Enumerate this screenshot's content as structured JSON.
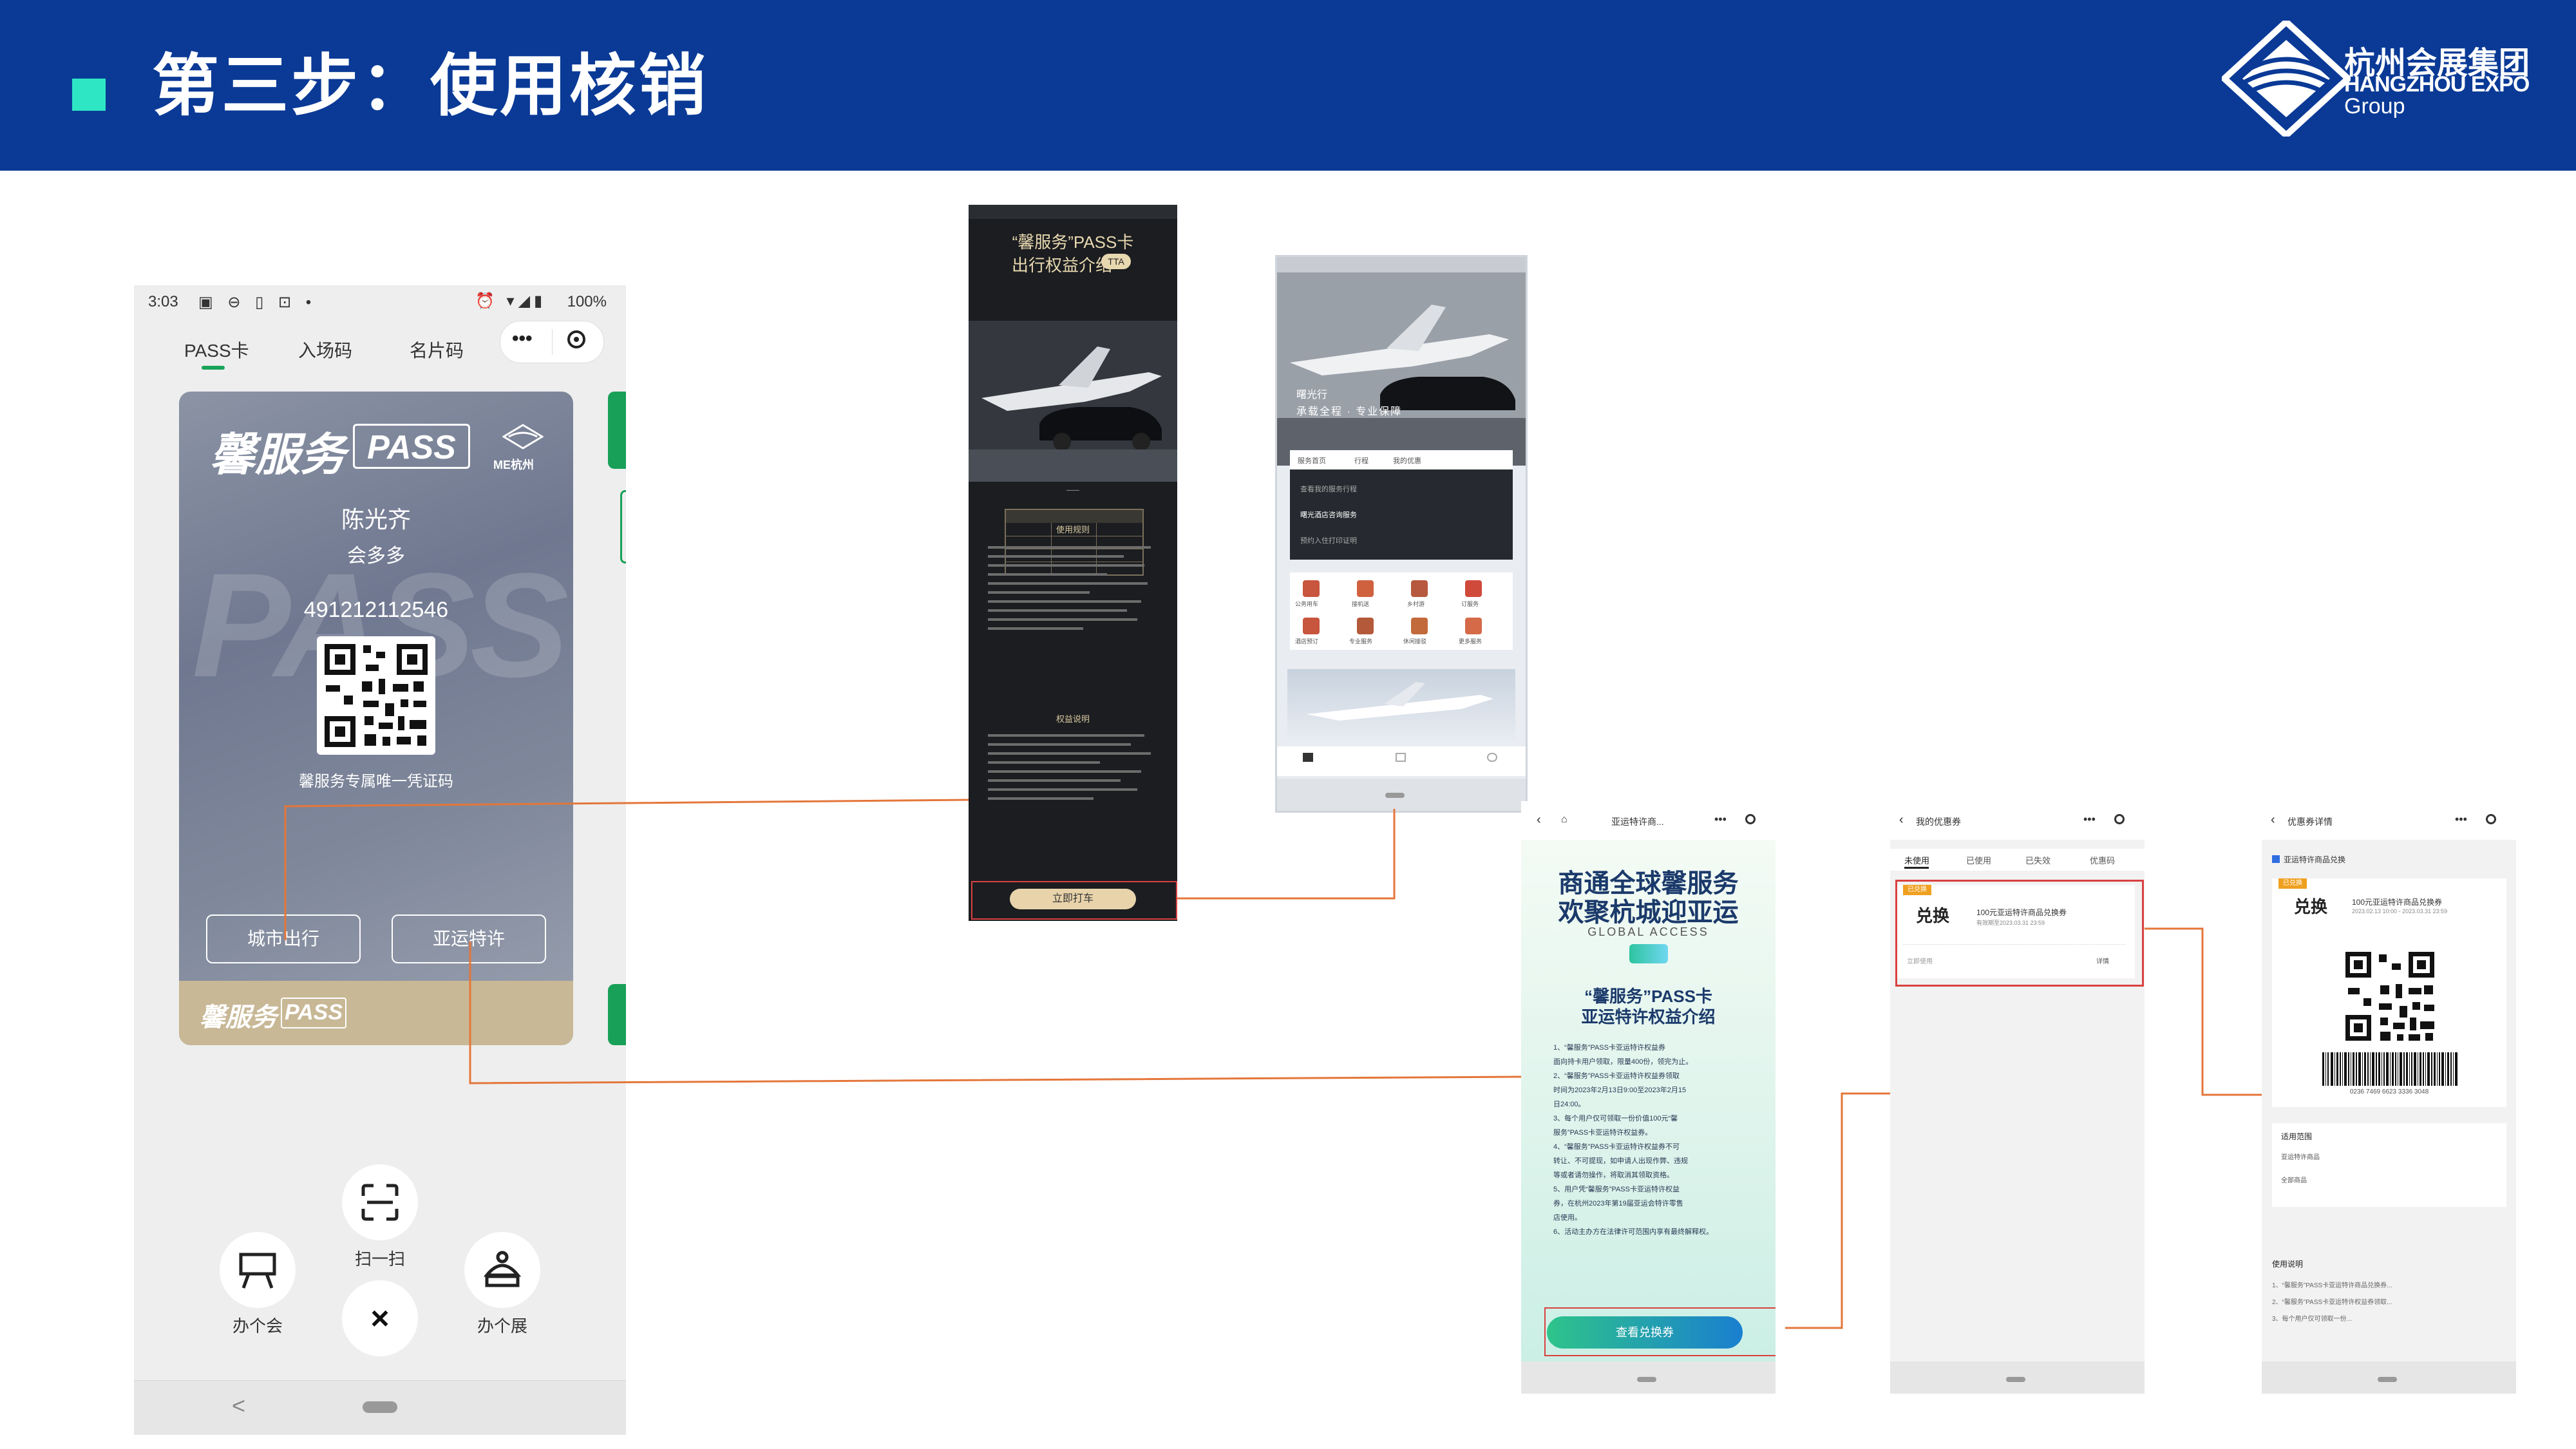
{
  "header": {
    "title": "第三步：使用核销",
    "logo_cn": "杭州会展集团",
    "logo_en_line1": "HANGZHOU EXPO",
    "logo_en_line2": "Group"
  },
  "phone": {
    "status_time": "3:03",
    "status_battery": "100%",
    "tabs": [
      "PASS卡",
      "入场码",
      "名片码"
    ],
    "menu_dots": "•••",
    "card": {
      "brand": "馨服务",
      "brand_pass": "PASS",
      "watermark": "PASS",
      "logo_text": "ME杭州",
      "holder_name": "陈光齐",
      "company": "会多多",
      "number": "491212112546",
      "qr_caption": "馨服务专属唯一凭证码",
      "btn_city": "城市出行",
      "btn_asian_games": "亚运特许",
      "footer_brand": "馨服务",
      "footer_pass": "PASS"
    },
    "dock": {
      "scan_label": "扫一扫",
      "meeting_label": "办个会",
      "exhibition_label": "办个展",
      "close_symbol": "×"
    },
    "nav_back": "<"
  },
  "shot_city": {
    "title_line1": "“馨服务”PASS卡",
    "title_line2": "出行权益介绍",
    "badge": "TTA",
    "section1": "使用规则",
    "section2": "权益说明",
    "button": "立即打车"
  },
  "shot_home": {
    "caption1": "曙光行",
    "caption2": "承载全程 · 专业保障",
    "tab_labels": [
      "服务首页",
      "行程",
      "我的优惠"
    ],
    "menu_items": [
      "查看我的服务行程",
      "曙光酒店咨询服务",
      "预约入住打印证明"
    ],
    "icon_labels": [
      "公务用车",
      "接机送",
      "乡村游",
      "订服务",
      "酒店预订",
      "专业服务",
      "休闲接驳",
      "更多服务"
    ]
  },
  "shot_asian": {
    "title_nav": "亚运特许商...",
    "headline1": "商通全球馨服务",
    "headline2": "欢聚杭城迎亚运",
    "global_access": "GLOBAL ACCESS",
    "intro_line1": "“馨服务”PASS卡",
    "intro_line2": "亚运特许权益介绍",
    "body_lines": [
      "1、“馨服务”PASS卡亚运特许权益券",
      "面向持卡用户领取，限量400份，领完为止。",
      "2、“馨服务”PASS卡亚运特许权益券领取",
      "时间为2023年2月13日9:00至2023年2月15",
      "日24:00。",
      "3、每个用户仅可领取一份价值100元“馨",
      "服务”PASS卡亚运特许权益券。",
      "4、“馨服务”PASS卡亚运特许权益券不可",
      "转让、不可提现，如申请人出现作弊、违规",
      "等或者请勿操作，将取消其领取资格。",
      "5、用户凭“馨服务”PASS卡亚运特许权益",
      "券，在杭州2023年第19届亚运会特许零售",
      "店使用。",
      "6、活动主办方在法律许可范围内享有最终解释权。"
    ],
    "button": "查看兑换券"
  },
  "shot_coupons": {
    "title": "我的优惠券",
    "tabs": [
      "未使用",
      "已使用",
      "已失效",
      "优惠码"
    ],
    "tag": "已兑换",
    "exchange": "兑换",
    "desc": "100元亚运特许商品兑换券",
    "desc_sub": "有效期至2023.03.31 23:59",
    "use_hint": "立即使用",
    "action": "详情"
  },
  "shot_detail": {
    "title": "优惠券详情",
    "subtitle": "亚运特许商品兑换",
    "exchange": "兑换",
    "desc": "100元亚运特许商品兑换券",
    "desc_sub": "2023.02.13 10:00 - 2023.03.31 23:59",
    "barcode_number": "0236 7469 6623 3336 3048",
    "info_title": "适用范围",
    "info_items": [
      "亚运特许商品",
      "全部商品"
    ],
    "notes_title": "使用说明",
    "notes": [
      "1、“馨服务”PASS卡亚运特许商品兑换券...",
      "2、“馨服务”PASS卡亚运特许权益券领取...",
      "3、每个用户仅可领取一份..."
    ]
  },
  "colors": {
    "header_bg": "#0a3a96",
    "accent_teal": "#2ee6c4",
    "connector": "#e4763a",
    "highlight_red": "#d94141",
    "green": "#18a058"
  }
}
